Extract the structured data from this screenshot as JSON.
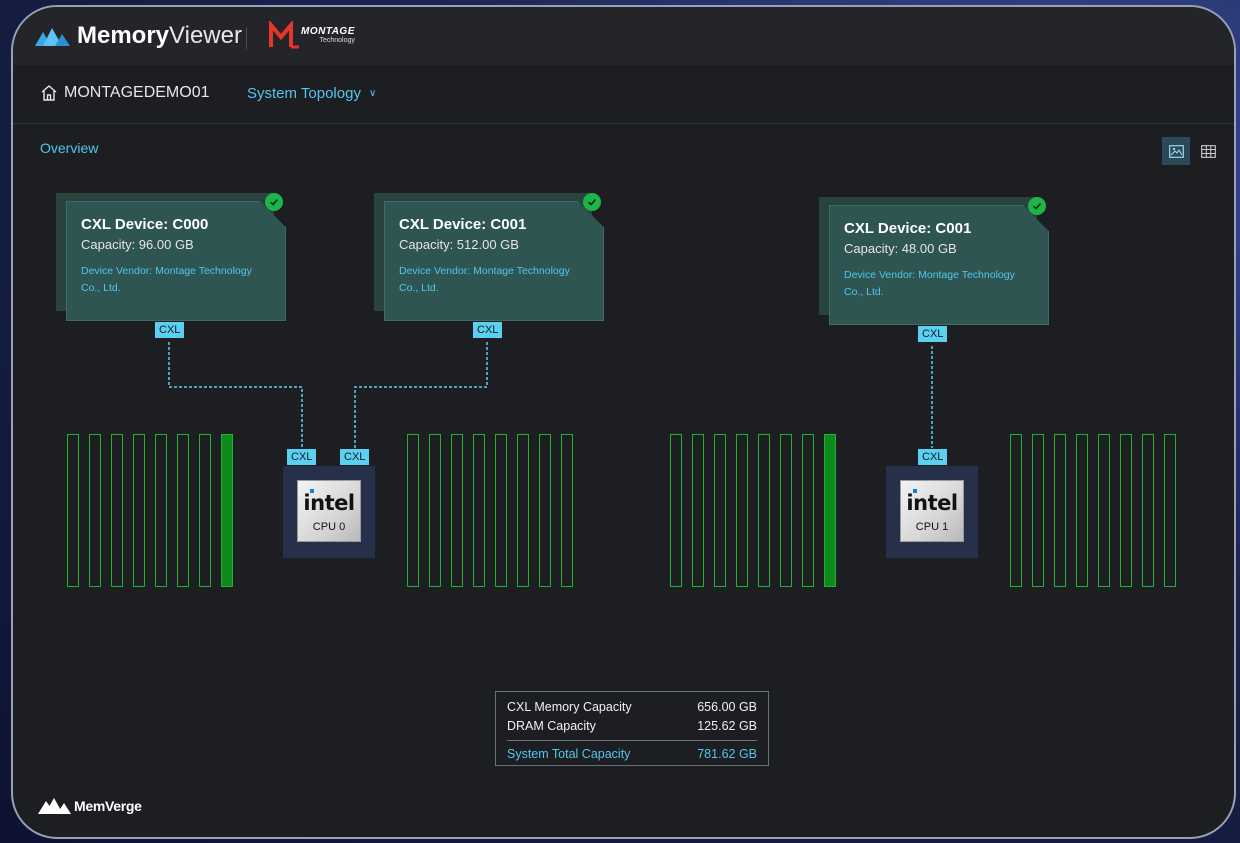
{
  "app": {
    "brand_bold": "Memory",
    "brand_light": "Viewer",
    "partner_line1": "MONTAGE",
    "partner_line2": "Technology"
  },
  "nav": {
    "host": "MONTAGEDEMO01",
    "view_dropdown": "System Topology"
  },
  "main": {
    "section_label": "Overview",
    "view_modes": [
      "image-view-icon",
      "table-view-icon"
    ]
  },
  "devices": [
    {
      "title": "CXL Device: C000",
      "capacity": "Capacity: 96.00 GB",
      "vendor": "Device Vendor: Montage Technology Co., Ltd.",
      "link": "CXL",
      "status": "ok"
    },
    {
      "title": "CXL Device: C001",
      "capacity": "Capacity: 512.00 GB",
      "vendor": "Device Vendor: Montage Technology Co., Ltd.",
      "link": "CXL",
      "status": "ok"
    },
    {
      "title": "CXL Device: C001",
      "capacity": "Capacity: 48.00 GB",
      "vendor": "Device Vendor: Montage Technology Co., Ltd.",
      "link": "CXL",
      "status": "ok"
    }
  ],
  "cpus": [
    {
      "brand": "intel",
      "label": "CPU 0",
      "ports": [
        "CXL",
        "CXL"
      ]
    },
    {
      "brand": "intel",
      "label": "CPU 1",
      "ports": [
        "CXL"
      ]
    }
  ],
  "summary": {
    "cxl_label": "CXL Memory Capacity",
    "cxl_value": "656.00 GB",
    "dram_label": "DRAM Capacity",
    "dram_value": "125.62 GB",
    "total_label": "System Total Capacity",
    "total_value": "781.62 GB"
  },
  "footer": {
    "company": "MemVerge"
  },
  "colors": {
    "accent": "#52c6ee",
    "dimm_outline": "#22b12e",
    "dimm_filled": "#0f8a1e",
    "status_ok": "#1db54a",
    "card": "#2e5551"
  }
}
